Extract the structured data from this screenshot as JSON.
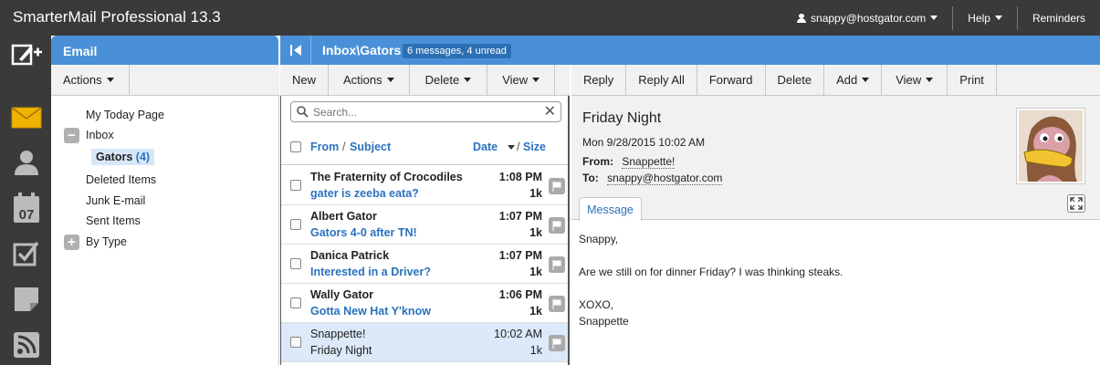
{
  "app": {
    "title": "SmarterMail Professional 13.3",
    "user": "snappy@hostgator.com",
    "help": "Help",
    "reminders": "Reminders"
  },
  "email_pane": {
    "title": "Email",
    "actions_label": "Actions",
    "folders": {
      "today": "My Today Page",
      "inbox": "Inbox",
      "gators": "Gators",
      "gators_count": "(4)",
      "deleted": "Deleted Items",
      "junk": "Junk E-mail",
      "sent": "Sent Items",
      "bytype": "By Type"
    }
  },
  "list_pane": {
    "path": "Inbox\\Gators",
    "badge": "6 messages, 4 unread",
    "toolbar": {
      "new": "New",
      "actions": "Actions",
      "delete": "Delete",
      "view": "View"
    },
    "search_placeholder": "Search...",
    "headers": {
      "from": "From",
      "sep1": "/",
      "subject": "Subject",
      "date": "Date",
      "sep2": "/",
      "size": "Size"
    },
    "messages": [
      {
        "from": "The Fraternity of Crocodiles",
        "subject": "gater is zeeba eata?",
        "time": "1:08 PM",
        "size": "1k"
      },
      {
        "from": "Albert Gator",
        "subject": "Gators 4-0 after TN!",
        "time": "1:07 PM",
        "size": "1k"
      },
      {
        "from": "Danica Patrick",
        "subject": "Interested in a Driver?",
        "time": "1:07 PM",
        "size": "1k"
      },
      {
        "from": "Wally Gator",
        "subject": "Gotta New Hat Y'know",
        "time": "1:06 PM",
        "size": "1k"
      },
      {
        "from": "Snappette!",
        "subject": "Friday Night",
        "time": "10:02 AM",
        "size": "1k"
      }
    ]
  },
  "read_pane": {
    "toolbar": {
      "reply": "Reply",
      "reply_all": "Reply All",
      "forward": "Forward",
      "delete": "Delete",
      "add": "Add",
      "view": "View",
      "print": "Print"
    },
    "subject": "Friday Night",
    "date": "Mon 9/28/2015 10:02 AM",
    "from_label": "From:",
    "from": "Snappette!",
    "to_label": "To:",
    "to": "snappy@hostgator.com",
    "tab": "Message",
    "body": {
      "greeting": "Snappy,",
      "line1": "Are we still on for dinner Friday? I was thinking steaks.",
      "signoff": "XOXO,",
      "signature": "Snappette"
    }
  }
}
